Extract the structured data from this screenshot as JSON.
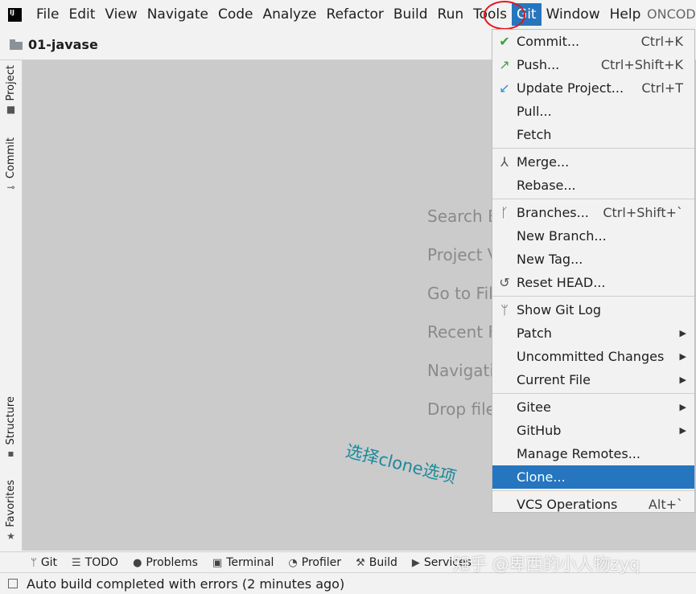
{
  "menubar": {
    "logo": "IJ",
    "items": [
      "File",
      "Edit",
      "View",
      "Navigate",
      "Code",
      "Analyze",
      "Refactor",
      "Build",
      "Run",
      "Tools",
      "Git",
      "Window",
      "Help"
    ],
    "active": "Git",
    "project_label": "ONCOD"
  },
  "navbar": {
    "project": "01-javase"
  },
  "left_strip": {
    "tabs": [
      "Project",
      "Commit",
      "Structure",
      "Favorites"
    ]
  },
  "editor": {
    "hints": [
      "Search E",
      "Project V",
      "Go to Fil",
      "Recent F",
      "Navigati",
      "Drop file"
    ],
    "annotation": "选择clone选项"
  },
  "git_menu": {
    "sections": [
      [
        {
          "label": "Commit...",
          "shortcut": "Ctrl+K",
          "icon": "check-icon"
        },
        {
          "label": "Push...",
          "shortcut": "Ctrl+Shift+K",
          "icon": "push-arrow-icon"
        },
        {
          "label": "Update Project...",
          "shortcut": "Ctrl+T",
          "icon": "update-arrow-icon"
        },
        {
          "label": "Pull..."
        },
        {
          "label": "Fetch"
        }
      ],
      [
        {
          "label": "Merge...",
          "icon": "merge-icon"
        },
        {
          "label": "Rebase..."
        }
      ],
      [
        {
          "label": "Branches...",
          "shortcut": "Ctrl+Shift+`",
          "icon": "branch-icon"
        },
        {
          "label": "New Branch..."
        },
        {
          "label": "New Tag..."
        },
        {
          "label": "Reset HEAD...",
          "icon": "undo-icon"
        }
      ],
      [
        {
          "label": "Show Git Log",
          "icon": "git-log-icon"
        },
        {
          "label": "Patch",
          "submenu": true
        },
        {
          "label": "Uncommitted Changes",
          "submenu": true
        },
        {
          "label": "Current File",
          "submenu": true
        }
      ],
      [
        {
          "label": "Gitee",
          "submenu": true
        },
        {
          "label": "GitHub",
          "submenu": true
        },
        {
          "label": "Manage Remotes..."
        },
        {
          "label": "Clone...",
          "selected": true
        }
      ],
      [
        {
          "label": "VCS Operations",
          "shortcut": "Alt+`"
        }
      ]
    ]
  },
  "bottom_bar": {
    "tabs": [
      {
        "label": "Git",
        "icon": "git-icon"
      },
      {
        "label": "TODO",
        "icon": "list-icon"
      },
      {
        "label": "Problems",
        "icon": "problems-icon"
      },
      {
        "label": "Terminal",
        "icon": "terminal-icon"
      },
      {
        "label": "Profiler",
        "icon": "profiler-icon"
      },
      {
        "label": "Build",
        "icon": "hammer-icon"
      },
      {
        "label": "Services",
        "icon": "services-icon"
      }
    ]
  },
  "status_bar": {
    "text": "Auto build completed with errors (2 minutes ago)"
  },
  "watermark": "知乎 @卑西的小人物zyq",
  "colors": {
    "accent": "#2675bf",
    "annotation": "#1a8a9c",
    "highlight_circle": "#e5151b"
  }
}
